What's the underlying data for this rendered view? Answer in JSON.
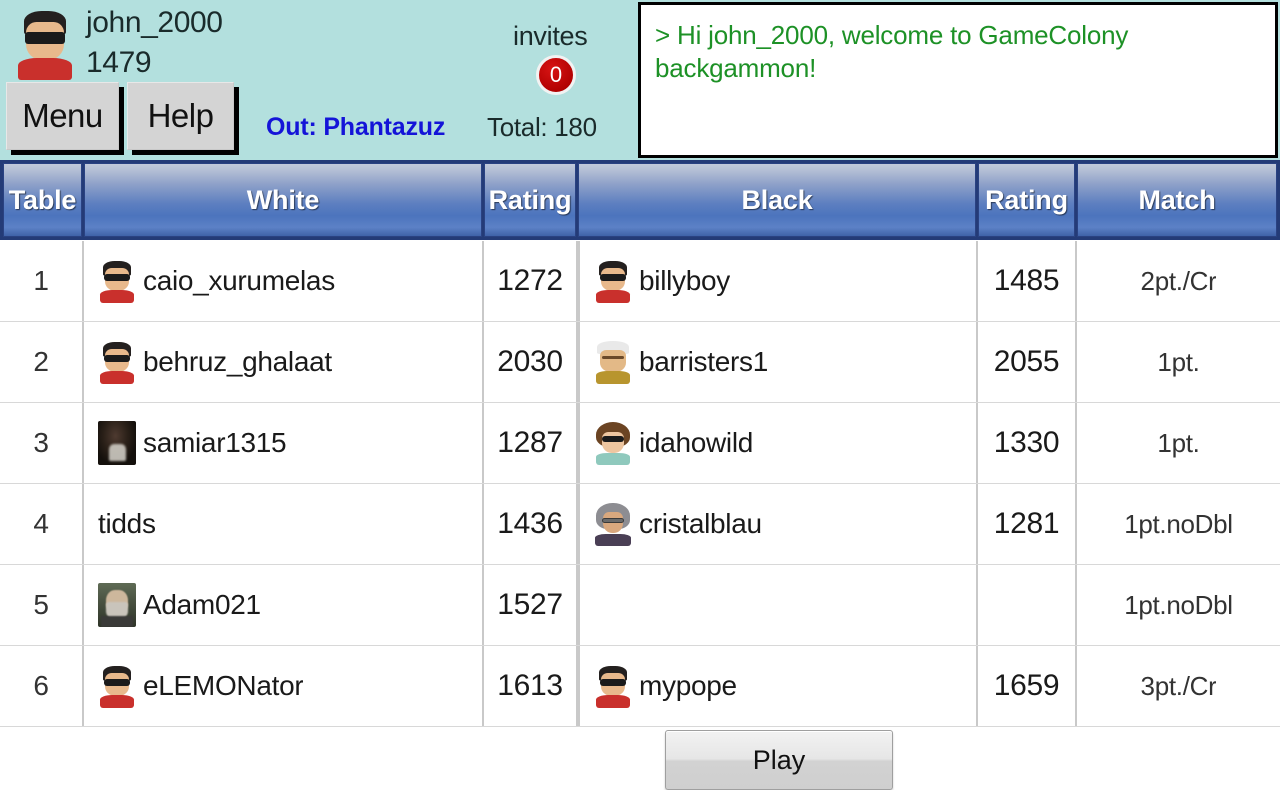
{
  "header": {
    "user": {
      "name": "john_2000",
      "rating": "1479",
      "avatar_icon": "dude-sunglasses-avatar"
    },
    "menu_button": "Menu",
    "help_button": "Help",
    "out_label": "Out: Phantazuz",
    "invites_label": "invites",
    "invites_count": "0",
    "total_label": "Total: 180",
    "chat_message": "> Hi john_2000, welcome to GameColony backgammon!",
    "colors": {
      "bar_background": "#b3e0de",
      "chat_text": "#1d9126",
      "out_text": "#1414d8",
      "badge": "#b00000"
    }
  },
  "table": {
    "columns": [
      "Table",
      "White",
      "Rating",
      "Black",
      "Rating",
      "Match"
    ],
    "play_button": "Play",
    "rows": [
      {
        "table": "1",
        "white": "caio_xurumelas",
        "white_avatar": "dude-sunglasses-avatar",
        "white_rating": "1272",
        "black": "billyboy",
        "black_avatar": "dude-sunglasses-avatar",
        "black_rating": "1485",
        "match": "2pt./Cr"
      },
      {
        "table": "2",
        "white": "behruz_ghalaat",
        "white_avatar": "dude-sunglasses-avatar",
        "white_rating": "2030",
        "black": "barristers1",
        "black_avatar": "cap-man-avatar",
        "black_rating": "2055",
        "match": "1pt."
      },
      {
        "table": "3",
        "white": "samiar1315",
        "white_avatar": "photo-dark-avatar",
        "white_rating": "1287",
        "black": "idahowild",
        "black_avatar": "curly-woman-avatar",
        "black_rating": "1330",
        "match": "1pt."
      },
      {
        "table": "4",
        "white": "tidds",
        "white_avatar": "",
        "white_rating": "1436",
        "black": "cristalblau",
        "black_avatar": "gray-woman-avatar",
        "black_rating": "1281",
        "match": "1pt.noDbl"
      },
      {
        "table": "5",
        "white": "Adam021",
        "white_avatar": "photo-man-avatar",
        "white_rating": "1527",
        "black": "",
        "black_avatar": "",
        "black_rating": "",
        "match": "1pt.noDbl"
      },
      {
        "table": "6",
        "white": "eLEMONator",
        "white_avatar": "dude-sunglasses-avatar",
        "white_rating": "1613",
        "black": "mypope",
        "black_avatar": "dude-sunglasses-avatar",
        "black_rating": "1659",
        "match": "3pt./Cr"
      }
    ]
  }
}
